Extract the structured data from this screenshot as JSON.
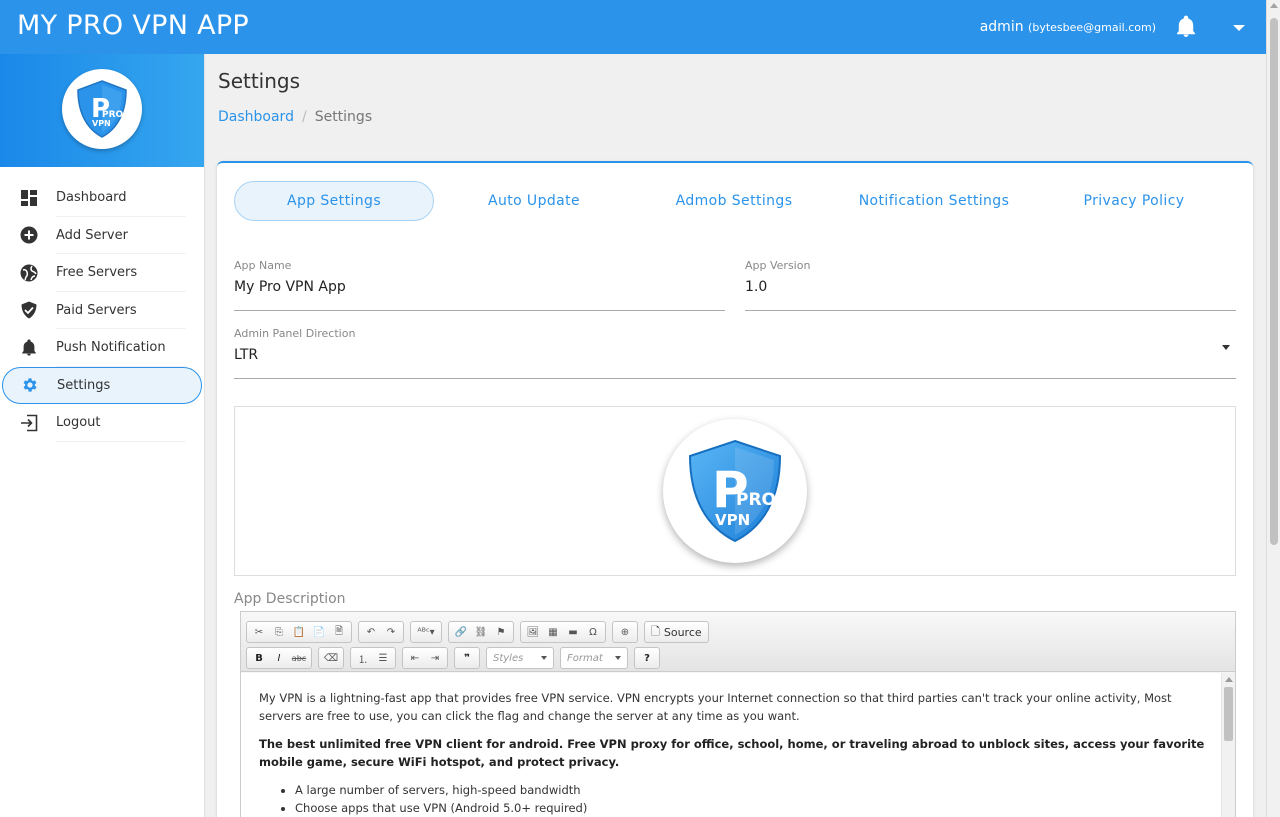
{
  "header": {
    "title": "MY PRO VPN APP",
    "user_name": "admin",
    "user_email": "(bytesbee@gmail.com)",
    "brand_color": "#2b93ea"
  },
  "sidebar": {
    "logo_text_1": "PRO",
    "logo_text_2": "VPN",
    "items": [
      {
        "label": "Dashboard",
        "icon": "dashboard-icon"
      },
      {
        "label": "Add Server",
        "icon": "add-circle-icon"
      },
      {
        "label": "Free Servers",
        "icon": "globe-icon"
      },
      {
        "label": "Paid Servers",
        "icon": "shield-check-icon"
      },
      {
        "label": "Push Notification",
        "icon": "bell-icon"
      },
      {
        "label": "Settings",
        "icon": "gear-icon",
        "active": true
      },
      {
        "label": "Logout",
        "icon": "logout-icon"
      }
    ]
  },
  "page": {
    "title": "Settings",
    "breadcrumb": {
      "home": "Dashboard",
      "separator": "/",
      "current": "Settings"
    }
  },
  "tabs": [
    {
      "label": "App Settings",
      "active": true
    },
    {
      "label": "Auto Update"
    },
    {
      "label": "Admob Settings"
    },
    {
      "label": "Notification Settings"
    },
    {
      "label": "Privacy Policy"
    }
  ],
  "form": {
    "app_name": {
      "label": "App Name",
      "value": "My Pro VPN App"
    },
    "app_version": {
      "label": "App Version",
      "value": "1.0"
    },
    "direction": {
      "label": "Admin Panel Direction",
      "value": "LTR"
    },
    "description_label": "App Description"
  },
  "editor": {
    "source_label": "Source",
    "styles_label": "Styles",
    "format_label": "Format",
    "paragraph_1": "My VPN is a lightning-fast app that provides free VPN service. VPN encrypts your Internet connection so that third parties can't track your online activity, Most servers are free to use, you can click the flag and change the server at any time as you want.",
    "paragraph_2": "The best unlimited free VPN client for android. Free VPN proxy for office, school, home, or traveling abroad to unblock sites, access your favorite mobile game, secure WiFi hotspot, and protect privacy.",
    "bullets": [
      "A large number of servers, high-speed bandwidth",
      "Choose apps that use VPN (Android 5.0+ required)"
    ]
  }
}
